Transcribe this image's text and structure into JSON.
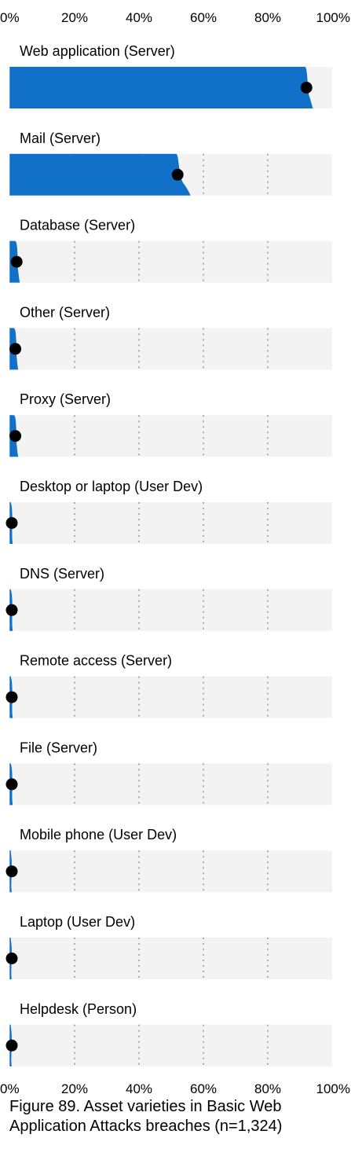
{
  "caption": "Figure 89. Asset varieties in Basic Web Application Attacks breaches (n=1,324)",
  "colors": {
    "fill": "#1170c7",
    "panel": "#f3f3f3",
    "point": "#000000",
    "grid": "#888888"
  },
  "chart_data": {
    "type": "bar",
    "orientation": "horizontal",
    "style": "interval-slab with point estimate",
    "xlim": [
      0,
      100
    ],
    "ticks": [
      "0%",
      "20%",
      "40%",
      "60%",
      "80%",
      "100%"
    ],
    "tick_values": [
      0,
      20,
      40,
      60,
      80,
      100
    ],
    "grid": "dotted vertical",
    "categories": [
      "Web application (Server)",
      "Mail (Server)",
      "Database (Server)",
      "Other (Server)",
      "Proxy (Server)",
      "Desktop or laptop (User Dev)",
      "DNS (Server)",
      "Remote access (Server)",
      "File (Server)",
      "Mobile phone (User Dev)",
      "Laptop (User Dev)",
      "Helpdesk (Person)"
    ],
    "values": [
      92,
      52,
      2,
      1.6,
      1.6,
      0.4,
      0.4,
      0.4,
      0.4,
      0.2,
      0.2,
      0.2
    ],
    "upper": [
      94,
      56,
      3,
      2.5,
      2.5,
      0.8,
      0.8,
      0.8,
      0.8,
      0.4,
      0.4,
      0.4
    ]
  }
}
